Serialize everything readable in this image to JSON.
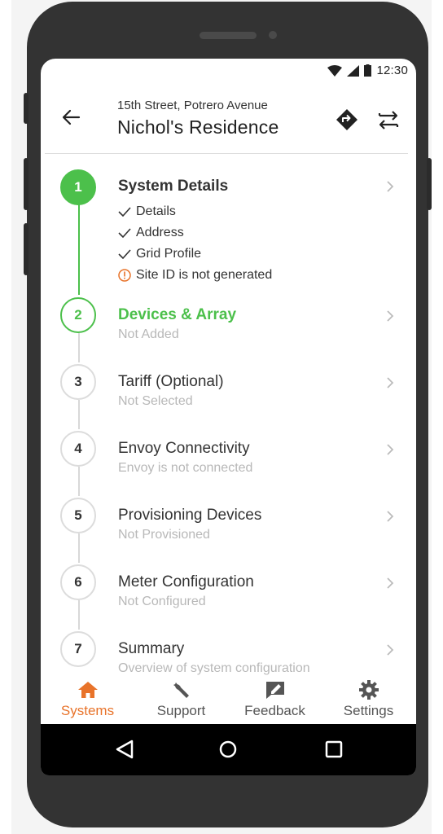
{
  "status_bar": {
    "time": "12:30"
  },
  "header": {
    "subtitle": "15th Street, Potrero Avenue",
    "title": "Nichol's Residence"
  },
  "steps": [
    {
      "number": "1",
      "title": "System Details",
      "checks": [
        "Details",
        "Address",
        "Grid Profile"
      ],
      "warning": "Site ID is not generated"
    },
    {
      "number": "2",
      "title": "Devices & Array",
      "subtitle": "Not Added"
    },
    {
      "number": "3",
      "title": "Tariff (Optional)",
      "subtitle": "Not Selected"
    },
    {
      "number": "4",
      "title": "Envoy Connectivity",
      "subtitle": "Envoy is not connected"
    },
    {
      "number": "5",
      "title": "Provisioning Devices",
      "subtitle": "Not Provisioned"
    },
    {
      "number": "6",
      "title": "Meter Configuration",
      "subtitle": "Not Configured"
    },
    {
      "number": "7",
      "title": "Summary",
      "subtitle": "Overview of system configuration"
    }
  ],
  "bottom_nav": [
    {
      "label": "Systems",
      "icon": "home-icon",
      "active": true
    },
    {
      "label": "Support",
      "icon": "wrench-icon",
      "active": false
    },
    {
      "label": "Feedback",
      "icon": "feedback-icon",
      "active": false
    },
    {
      "label": "Settings",
      "icon": "gear-icon",
      "active": false
    }
  ],
  "colors": {
    "accent_green": "#4cc04b",
    "accent_orange": "#e8732a",
    "warning_orange": "#e8732a"
  }
}
